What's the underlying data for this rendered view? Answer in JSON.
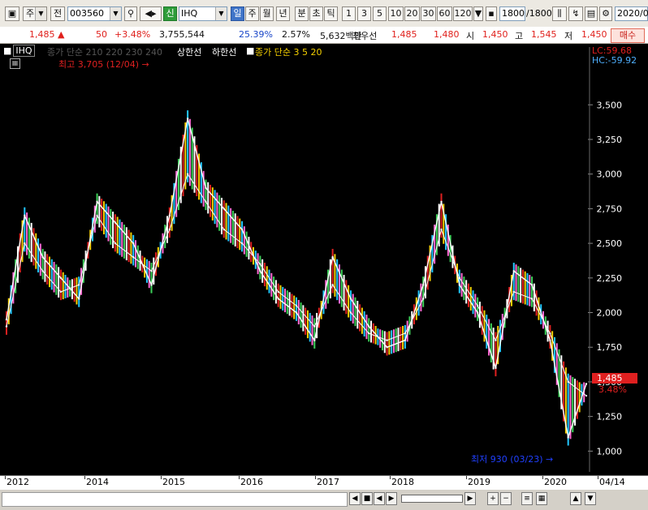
{
  "toolbar": {
    "market": "주",
    "mode": "전",
    "code": "003560",
    "name_tag": "신",
    "name": "IHQ",
    "periods": [
      "일",
      "주",
      "월",
      "년",
      "분",
      "초",
      "틱"
    ],
    "selected_period": "일",
    "intervals": [
      "1",
      "3",
      "5",
      "10",
      "20",
      "30",
      "60",
      "120"
    ],
    "count": "1800",
    "count_total": "/1800",
    "date": "2020/0"
  },
  "quote": {
    "price": "1,485",
    "change": "50",
    "change_pct": "+3.48%",
    "volume": "3,755,544",
    "vol_ratio": "25.39%",
    "turnover": "2.57%",
    "amount": "5,632백만",
    "best_ask_label": "최우선",
    "ask": "1,485",
    "bid": "1,480",
    "open_label": "시",
    "open": "1,450",
    "high_label": "고",
    "high": "1,545",
    "low_label": "저",
    "low": "1,450",
    "buy_label": "매수"
  },
  "legend": {
    "code": "IHQ",
    "ma_line": "종가 단순 210 220 230 240",
    "upper": "상한선",
    "lower": "하한선",
    "ma2": "종가 단순 3 5 20",
    "lc": "LC:59.68",
    "hc": "HC:-59.92"
  },
  "annotations": {
    "max": "최고 3,705 (12/04)",
    "min": "최저 930 (03/23)",
    "current_price": "1,485",
    "current_pct": "3.48%"
  },
  "chart_data": {
    "type": "line",
    "title": "",
    "y_ticks": [
      "3,500",
      "3,250",
      "3,000",
      "2,750",
      "2,500",
      "2,250",
      "2,000",
      "1,750",
      "1,500",
      "1,250",
      "1,000"
    ],
    "ylim": [
      850,
      3800
    ],
    "x_labels": [
      "2012",
      "2014",
      "2015",
      "2016",
      "2017",
      "2018",
      "2019",
      "2020",
      "04/14"
    ],
    "x": [
      "2012-06",
      "2012-09",
      "2012-12",
      "2013-03",
      "2013-06",
      "2013-09",
      "2013-12",
      "2014-03",
      "2014-06",
      "2014-09",
      "2014-12",
      "2015-03",
      "2015-06",
      "2015-09",
      "2015-12",
      "2016-03",
      "2016-06",
      "2016-09",
      "2016-12",
      "2017-03",
      "2017-06",
      "2017-09",
      "2017-12",
      "2018-03",
      "2018-06",
      "2018-09",
      "2018-12",
      "2019-03",
      "2019-06",
      "2019-09",
      "2019-12",
      "2020-03",
      "2020-04"
    ],
    "series": [
      {
        "values": [
          1950,
          2700,
          2400,
          2250,
          2100,
          2800,
          2650,
          2500,
          2200,
          2700,
          3400,
          2900,
          2750,
          2600,
          2300,
          2100,
          2000,
          1800,
          2400,
          2100,
          1900,
          1750,
          1800,
          2200,
          2800,
          2200,
          2000,
          1600,
          2300,
          2200,
          1800,
          1100,
          1485
        ]
      },
      {
        "values": [
          1900,
          2500,
          2300,
          2150,
          2200,
          2700,
          2500,
          2400,
          2300,
          2600,
          3000,
          2800,
          2600,
          2500,
          2350,
          2150,
          2050,
          1900,
          2200,
          2000,
          1850,
          1800,
          1850,
          2100,
          2600,
          2250,
          2050,
          1800,
          2150,
          2100,
          1850,
          1500,
          1400
        ]
      }
    ]
  },
  "bottom": {
    "buttons": [
      "◀",
      "■",
      "◀",
      "▶",
      "+",
      "−",
      "≡",
      "▦",
      "▲",
      "▼"
    ]
  }
}
